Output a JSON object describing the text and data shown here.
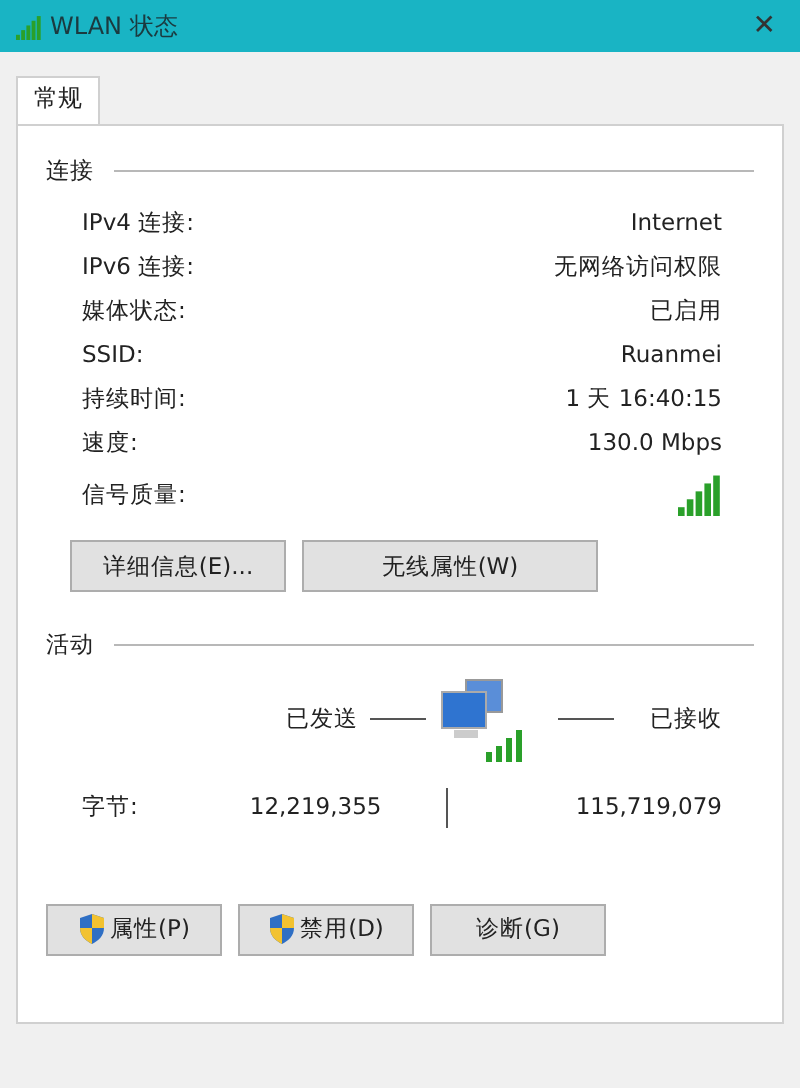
{
  "window": {
    "title": "WLAN 状态",
    "close": "✕"
  },
  "tabs": [
    {
      "label": "常规",
      "selected": true
    }
  ],
  "connection": {
    "heading": "连接",
    "rows": [
      {
        "label": "IPv4 连接:",
        "value": "Internet",
        "kind": "text"
      },
      {
        "label": "IPv6 连接:",
        "value": "无网络访问权限",
        "kind": "text"
      },
      {
        "label": "媒体状态:",
        "value": "已启用",
        "kind": "text"
      },
      {
        "label": "SSID:",
        "value": "Ruanmei",
        "kind": "text"
      },
      {
        "label": "持续时间:",
        "value": "1 天 16:40:15",
        "kind": "text"
      },
      {
        "label": "速度:",
        "value": "130.0 Mbps",
        "kind": "text"
      },
      {
        "label": "信号质量:",
        "kind": "signal"
      }
    ],
    "buttons": [
      "详细信息(E)...",
      "无线属性(W)"
    ]
  },
  "activity": {
    "heading": "活动",
    "sent_label": "已发送",
    "received_label": "已接收",
    "bytes_label": "字节:",
    "sent": "12,219,355",
    "received": "115,719,079",
    "buttons": [
      {
        "label": "属性(P)",
        "shield": true
      },
      {
        "label": "禁用(D)",
        "shield": true
      },
      {
        "label": "诊断(G)",
        "shield": false
      }
    ]
  }
}
